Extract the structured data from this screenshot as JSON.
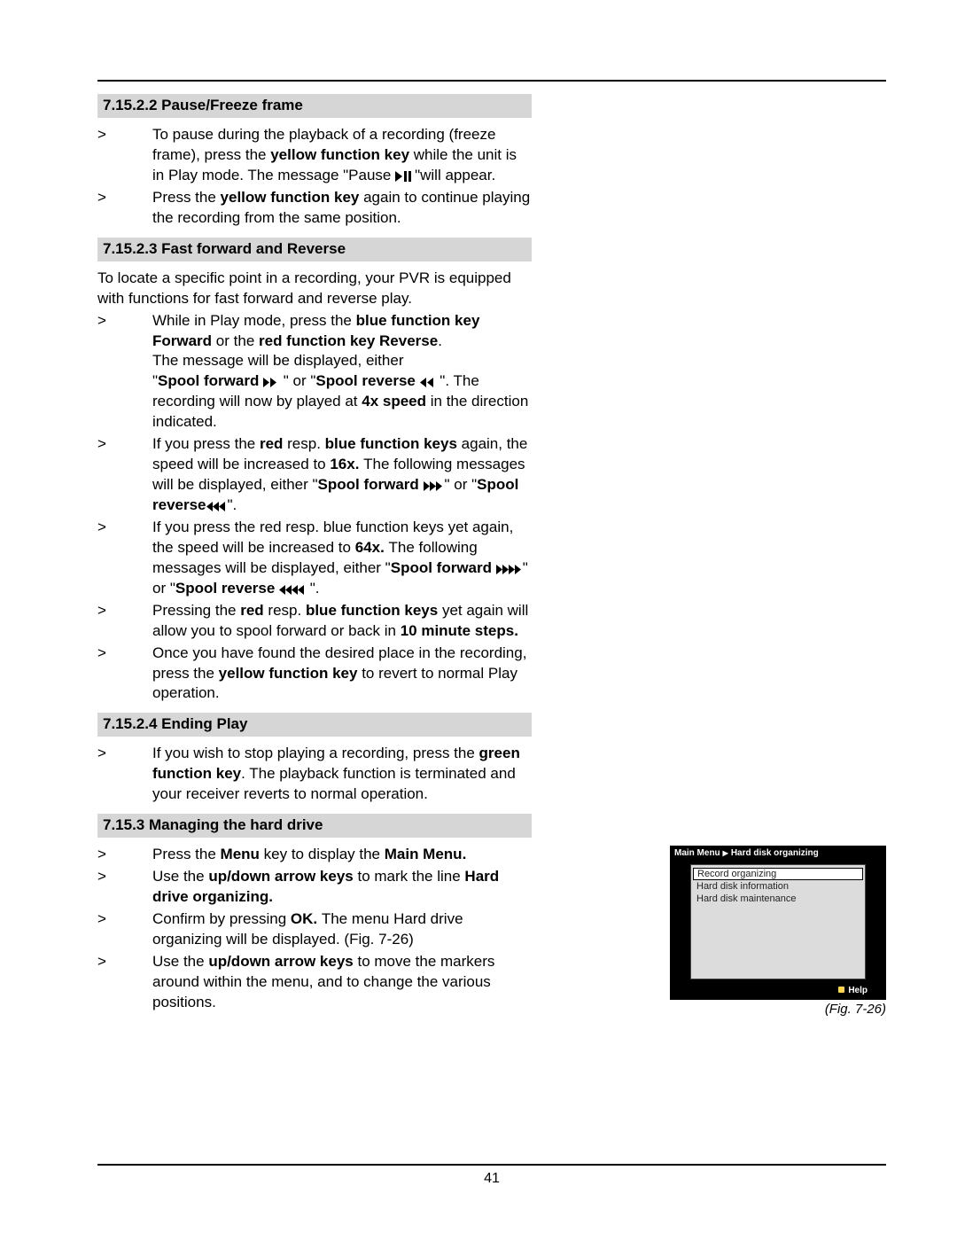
{
  "pageNumber": "41",
  "sections": {
    "pause": {
      "heading": "7.15.2.2 Pause/Freeze frame",
      "items": [
        {
          "prefix": "To pause during the playback of a recording (freeze frame), press the ",
          "b1": "yellow function key ",
          "mid": "while the unit is in Play mode. The message \"Pause  ",
          "after_icon": "\"will appear."
        },
        {
          "prefix": "Press the ",
          "b1": "yellow function key ",
          "suffix": "again to continue playing the recording from the same position."
        }
      ]
    },
    "ff": {
      "heading": "7.15.2.3  Fast forward and Reverse",
      "intro": "To locate a specific point in a recording, your PVR is equipped with functions for fast forward and reverse play.",
      "item1": {
        "a": "While in Play mode, press the ",
        "b": "blue function key Forward ",
        "c": "or the ",
        "d": "red function key Reverse",
        "e": ".",
        "line2": "The message will be displayed, either",
        "f": "\"",
        "g": "Spool forward ",
        "h": "  \" or \"",
        "i": "Spool reverse ",
        "j": "  \". The recording will now by played at ",
        "k": "4x speed ",
        "l": "in the direction indicated."
      },
      "item2": {
        "a": "If you press the ",
        "b": "red ",
        "c": "resp. ",
        "d": "blue function keys ",
        "e": "again, the speed will be increased to ",
        "f": "16x. ",
        "g": "The following messages will be displayed, either \"",
        "h": "Spool forward ",
        "i": "\" or \"",
        "j": "Spool reverse",
        "k": "\"."
      },
      "item3": {
        "a": "If you press the red resp. blue function keys yet again, the speed will be increased to ",
        "b": "64x. ",
        "c": "The following messages will be displayed, either \"",
        "d": "Spool forward ",
        "e": "\" or \"",
        "f": "Spool reverse ",
        "g": " \"."
      },
      "item4": {
        "a": "Pressing the ",
        "b": "red ",
        "c": "resp. ",
        "d": "blue function keys ",
        "e": "yet again will allow you to spool forward or back in ",
        "f": "10 minute steps."
      },
      "item5": {
        "a": "Once you have found the desired place in the recording, press the ",
        "b": "yellow function key ",
        "c": "to revert to normal Play operation."
      }
    },
    "end": {
      "heading": "7.15.2.4 Ending Play",
      "item": {
        "a": "If you wish to stop playing a recording, press the ",
        "b": "green function key",
        "c": ". The playback function is terminated and your receiver reverts to normal operation."
      }
    },
    "manage": {
      "heading": "7.15.3 Managing the hard drive",
      "item1": {
        "a": "Press the ",
        "b": "Menu ",
        "c": "key to display the ",
        "d": "Main Menu."
      },
      "item2": {
        "a": "Use the ",
        "b": "up/down arrow keys ",
        "c": "to mark the line ",
        "d": "Hard drive organizing."
      },
      "item3": {
        "a": "Confirm by pressing ",
        "b": "OK. ",
        "c": "The menu Hard drive organizing will be displayed. (Fig. 7-26)"
      },
      "item4": {
        "a": "Use the ",
        "b": "up/down arrow keys ",
        "c": "to move the markers around within the menu, and to change the various positions."
      }
    }
  },
  "figure": {
    "breadcrumb1": "Main Menu",
    "breadcrumb2": "Hard disk organizing",
    "items": [
      "Record organizing",
      "Hard disk information",
      "Hard disk maintenance"
    ],
    "help": "Help",
    "caption": "(Fig. 7-26)"
  }
}
